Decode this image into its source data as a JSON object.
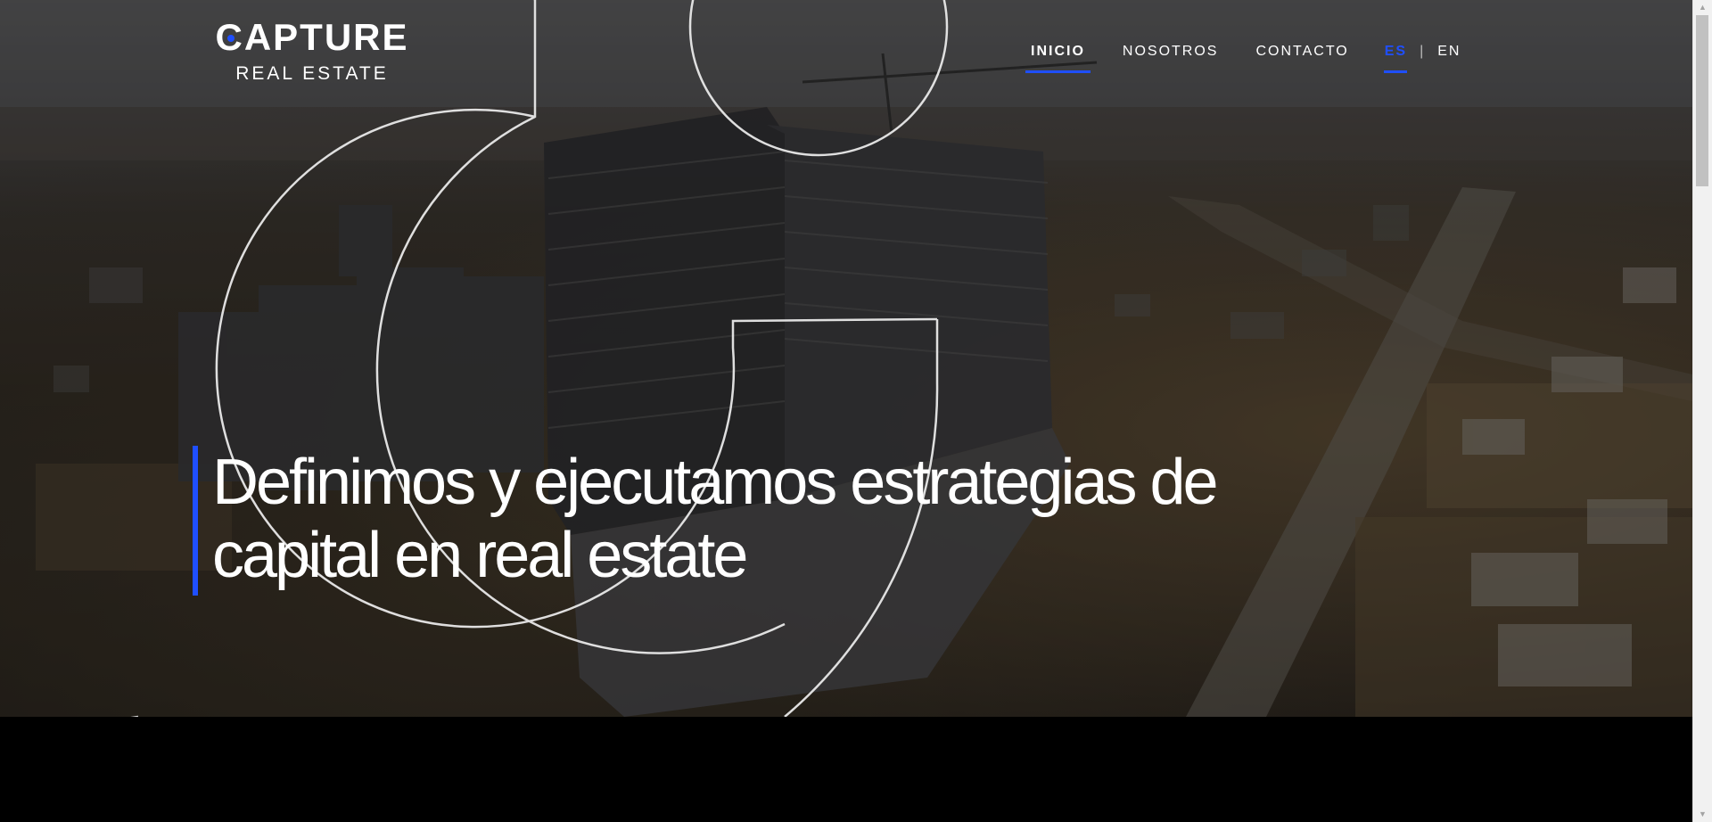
{
  "brand": {
    "name": "CAPTURE",
    "tagline": "REAL ESTATE",
    "accent_color": "#1f4fff"
  },
  "nav": {
    "items": [
      {
        "label": "INICIO",
        "active": true
      },
      {
        "label": "NOSOTROS",
        "active": false
      },
      {
        "label": "CONTACTO",
        "active": false
      }
    ],
    "languages": [
      {
        "label": "ES",
        "active": true
      },
      {
        "label": "EN",
        "active": false
      }
    ],
    "separator": "|"
  },
  "hero": {
    "headline_line1": "Definimos y ejecutamos estrategias de",
    "headline_line2": "capital en real estate",
    "background": "aerial-construction-site-photo"
  },
  "icons": {
    "scroll_up": "scroll-up-arrow-icon",
    "scroll_down": "scroll-down-arrow-icon"
  }
}
